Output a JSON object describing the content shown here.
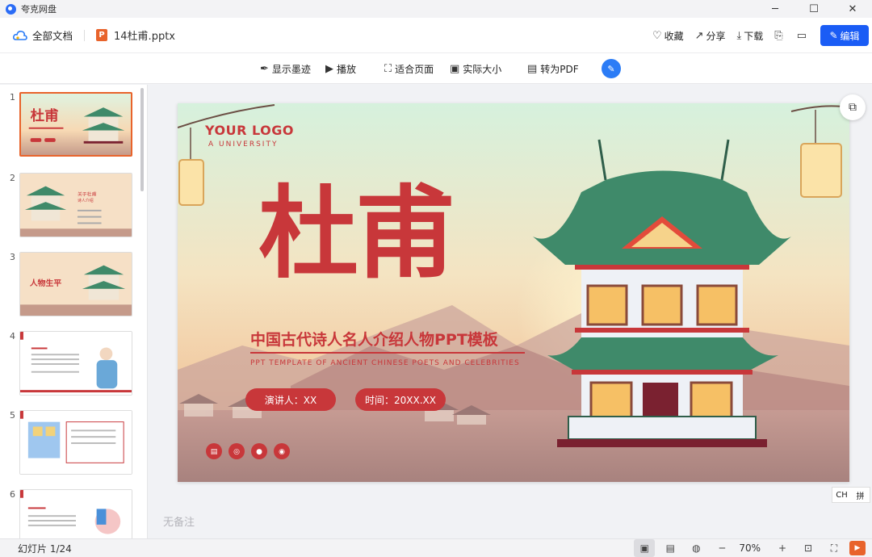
{
  "app": {
    "title": "夸克网盘"
  },
  "window_controls": {
    "minimize": "─",
    "maximize": "☐",
    "close": "✕"
  },
  "docbar": {
    "all_docs": "全部文档",
    "file_badge": "P",
    "filename": "14杜甫.pptx",
    "actions": {
      "favorite": "收藏",
      "share": "分享",
      "download": "下载",
      "edit": "编辑"
    }
  },
  "toolbar": {
    "ink": "显示墨迹",
    "play": "播放",
    "fit_page": "适合页面",
    "actual_size": "实际大小",
    "to_pdf": "转为PDF"
  },
  "thumbnails": {
    "numbers": [
      "1",
      "2",
      "3",
      "4",
      "5",
      "6"
    ],
    "t2_title": "关于杜甫",
    "t2_sub": "诗人介绍",
    "t3_title": "人物生平"
  },
  "slide": {
    "logo": "YOUR LOGO",
    "university": "A UNIVERSITY",
    "big_title": "杜甫",
    "cn_title": "中国古代诗人名人介绍人物PPT模板",
    "en_subtitle": "PPT TEMPLATE OF ANCIENT CHINESE POETS AND CELEBRITIES",
    "presenter": "演讲人：XX",
    "time": "时间：20XX.XX"
  },
  "notes": {
    "placeholder": "无备注"
  },
  "ime": {
    "lang": "CH",
    "mode": "拼"
  },
  "status": {
    "slide_count": "幻灯片 1/24",
    "zoom": "70%"
  },
  "colors": {
    "accent": "#1a5cf5",
    "brand_orange": "#e8632b",
    "slide_red": "#c8373a",
    "roof_green": "#3f8a6a"
  }
}
